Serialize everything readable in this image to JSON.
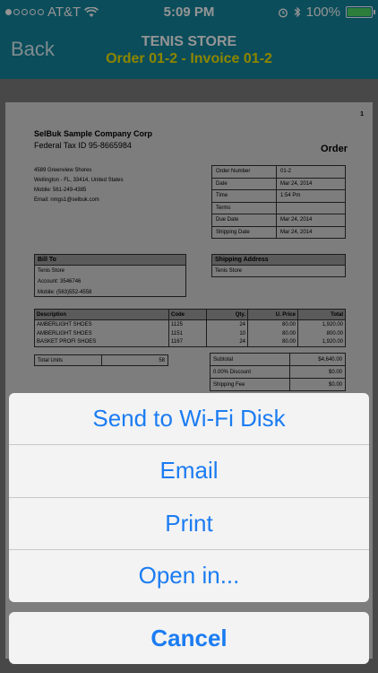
{
  "status_bar": {
    "carrier": "AT&T",
    "time": "5:09 PM",
    "battery": "100%"
  },
  "nav": {
    "back_label": "Back",
    "title": "TENIS STORE",
    "subtitle": "Order 01-2 - Invoice 01-2"
  },
  "document": {
    "page_number": "1",
    "company": "SelBuk Sample Company Corp",
    "tax_id": "Federal Tax ID 95-8665984",
    "doc_title": "Order",
    "address_lines": [
      "4589 Greenview Shores",
      "Wellington - FL, 33414, United States",
      "Mobile: 561-249-4385",
      "Email: nmgs1@selbuk.com"
    ],
    "info": [
      {
        "label": "Order Number",
        "value": "01-2"
      },
      {
        "label": "Date",
        "value": "Mar 24, 2014"
      },
      {
        "label": "Time",
        "value": "1:54 Pm"
      },
      {
        "label": "Terms",
        "value": ""
      },
      {
        "label": "Due Date",
        "value": "Mar 24, 2014"
      },
      {
        "label": "Shipping Date",
        "value": "Mar 24, 2014"
      }
    ],
    "bill_to": {
      "heading": "Bill To",
      "lines": [
        "Tenis Store",
        "Account: 3546746",
        "Mobile: (563)552-4558"
      ]
    },
    "ship_to": {
      "heading": "Shipping Address",
      "lines": [
        "Tenis Store"
      ]
    },
    "items_headers": {
      "description": "Description",
      "code": "Code",
      "qty": "Qty.",
      "price": "U. Price",
      "total": "Total"
    },
    "items": [
      {
        "description": "AMBERLIGHT SHOES",
        "code": "1125",
        "qty": "24",
        "price": "80.00",
        "total": "1,920.00"
      },
      {
        "description": "AMBERLIGHT SHOES",
        "code": "1151",
        "qty": "10",
        "price": "80.00",
        "total": "800.00"
      },
      {
        "description": "BASKET PROFI SHOES",
        "code": "1167",
        "qty": "24",
        "price": "80.00",
        "total": "1,920.00"
      }
    ],
    "total_units": {
      "label": "Total Units",
      "value": "58"
    },
    "totals": [
      {
        "label": "Subtotal",
        "value": "$4,640.00"
      },
      {
        "label": "0.00% Discount",
        "value": "$0.00"
      },
      {
        "label": "Shipping Fee",
        "value": "$0.00"
      }
    ]
  },
  "action_sheet": {
    "items": [
      "Send to Wi-Fi Disk",
      "Email",
      "Print",
      "Open in..."
    ],
    "cancel": "Cancel"
  },
  "colors": {
    "accent": "#1b7cf2",
    "nav_bg": "#13859e",
    "subtitle": "#f2e600"
  }
}
